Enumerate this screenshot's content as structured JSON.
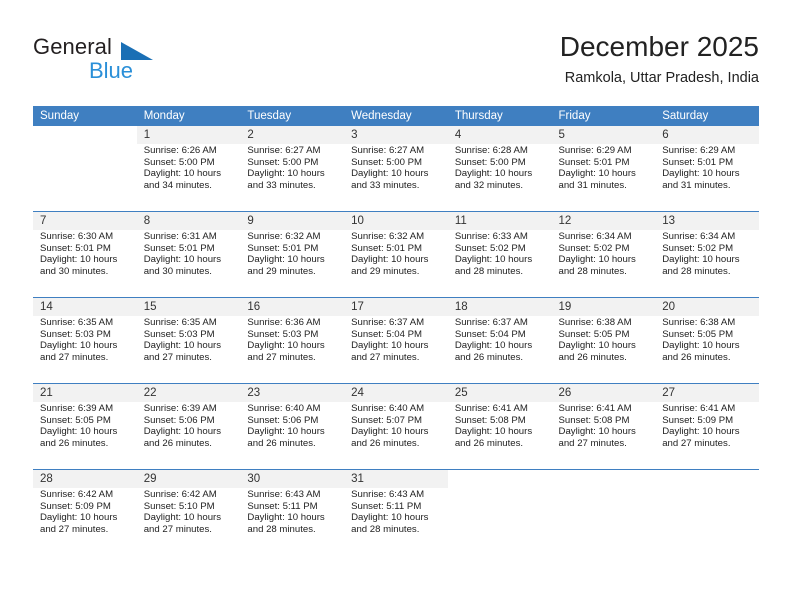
{
  "logo": {
    "word_dark": "General",
    "word_blue": "Blue",
    "triangle_color": "#1a6fb5",
    "blue_color": "#2a8fd8"
  },
  "header": {
    "title": "December 2025",
    "subtitle": "Ramkola, Uttar Pradesh, India"
  },
  "theme": {
    "header_bg": "#3f7fc1",
    "header_text": "#ffffff",
    "daynum_bg": "#f2f2f2",
    "cell_bg": "#ffffff"
  },
  "weekday_headers": [
    "Sunday",
    "Monday",
    "Tuesday",
    "Wednesday",
    "Thursday",
    "Friday",
    "Saturday"
  ],
  "weeks": [
    [
      {
        "day": "",
        "lines": []
      },
      {
        "day": "1",
        "lines": [
          "Sunrise: 6:26 AM",
          "Sunset: 5:00 PM",
          "Daylight: 10 hours",
          "and 34 minutes."
        ]
      },
      {
        "day": "2",
        "lines": [
          "Sunrise: 6:27 AM",
          "Sunset: 5:00 PM",
          "Daylight: 10 hours",
          "and 33 minutes."
        ]
      },
      {
        "day": "3",
        "lines": [
          "Sunrise: 6:27 AM",
          "Sunset: 5:00 PM",
          "Daylight: 10 hours",
          "and 33 minutes."
        ]
      },
      {
        "day": "4",
        "lines": [
          "Sunrise: 6:28 AM",
          "Sunset: 5:00 PM",
          "Daylight: 10 hours",
          "and 32 minutes."
        ]
      },
      {
        "day": "5",
        "lines": [
          "Sunrise: 6:29 AM",
          "Sunset: 5:01 PM",
          "Daylight: 10 hours",
          "and 31 minutes."
        ]
      },
      {
        "day": "6",
        "lines": [
          "Sunrise: 6:29 AM",
          "Sunset: 5:01 PM",
          "Daylight: 10 hours",
          "and 31 minutes."
        ]
      }
    ],
    [
      {
        "day": "7",
        "lines": [
          "Sunrise: 6:30 AM",
          "Sunset: 5:01 PM",
          "Daylight: 10 hours",
          "and 30 minutes."
        ]
      },
      {
        "day": "8",
        "lines": [
          "Sunrise: 6:31 AM",
          "Sunset: 5:01 PM",
          "Daylight: 10 hours",
          "and 30 minutes."
        ]
      },
      {
        "day": "9",
        "lines": [
          "Sunrise: 6:32 AM",
          "Sunset: 5:01 PM",
          "Daylight: 10 hours",
          "and 29 minutes."
        ]
      },
      {
        "day": "10",
        "lines": [
          "Sunrise: 6:32 AM",
          "Sunset: 5:01 PM",
          "Daylight: 10 hours",
          "and 29 minutes."
        ]
      },
      {
        "day": "11",
        "lines": [
          "Sunrise: 6:33 AM",
          "Sunset: 5:02 PM",
          "Daylight: 10 hours",
          "and 28 minutes."
        ]
      },
      {
        "day": "12",
        "lines": [
          "Sunrise: 6:34 AM",
          "Sunset: 5:02 PM",
          "Daylight: 10 hours",
          "and 28 minutes."
        ]
      },
      {
        "day": "13",
        "lines": [
          "Sunrise: 6:34 AM",
          "Sunset: 5:02 PM",
          "Daylight: 10 hours",
          "and 28 minutes."
        ]
      }
    ],
    [
      {
        "day": "14",
        "lines": [
          "Sunrise: 6:35 AM",
          "Sunset: 5:03 PM",
          "Daylight: 10 hours",
          "and 27 minutes."
        ]
      },
      {
        "day": "15",
        "lines": [
          "Sunrise: 6:35 AM",
          "Sunset: 5:03 PM",
          "Daylight: 10 hours",
          "and 27 minutes."
        ]
      },
      {
        "day": "16",
        "lines": [
          "Sunrise: 6:36 AM",
          "Sunset: 5:03 PM",
          "Daylight: 10 hours",
          "and 27 minutes."
        ]
      },
      {
        "day": "17",
        "lines": [
          "Sunrise: 6:37 AM",
          "Sunset: 5:04 PM",
          "Daylight: 10 hours",
          "and 27 minutes."
        ]
      },
      {
        "day": "18",
        "lines": [
          "Sunrise: 6:37 AM",
          "Sunset: 5:04 PM",
          "Daylight: 10 hours",
          "and 26 minutes."
        ]
      },
      {
        "day": "19",
        "lines": [
          "Sunrise: 6:38 AM",
          "Sunset: 5:05 PM",
          "Daylight: 10 hours",
          "and 26 minutes."
        ]
      },
      {
        "day": "20",
        "lines": [
          "Sunrise: 6:38 AM",
          "Sunset: 5:05 PM",
          "Daylight: 10 hours",
          "and 26 minutes."
        ]
      }
    ],
    [
      {
        "day": "21",
        "lines": [
          "Sunrise: 6:39 AM",
          "Sunset: 5:05 PM",
          "Daylight: 10 hours",
          "and 26 minutes."
        ]
      },
      {
        "day": "22",
        "lines": [
          "Sunrise: 6:39 AM",
          "Sunset: 5:06 PM",
          "Daylight: 10 hours",
          "and 26 minutes."
        ]
      },
      {
        "day": "23",
        "lines": [
          "Sunrise: 6:40 AM",
          "Sunset: 5:06 PM",
          "Daylight: 10 hours",
          "and 26 minutes."
        ]
      },
      {
        "day": "24",
        "lines": [
          "Sunrise: 6:40 AM",
          "Sunset: 5:07 PM",
          "Daylight: 10 hours",
          "and 26 minutes."
        ]
      },
      {
        "day": "25",
        "lines": [
          "Sunrise: 6:41 AM",
          "Sunset: 5:08 PM",
          "Daylight: 10 hours",
          "and 26 minutes."
        ]
      },
      {
        "day": "26",
        "lines": [
          "Sunrise: 6:41 AM",
          "Sunset: 5:08 PM",
          "Daylight: 10 hours",
          "and 27 minutes."
        ]
      },
      {
        "day": "27",
        "lines": [
          "Sunrise: 6:41 AM",
          "Sunset: 5:09 PM",
          "Daylight: 10 hours",
          "and 27 minutes."
        ]
      }
    ],
    [
      {
        "day": "28",
        "lines": [
          "Sunrise: 6:42 AM",
          "Sunset: 5:09 PM",
          "Daylight: 10 hours",
          "and 27 minutes."
        ]
      },
      {
        "day": "29",
        "lines": [
          "Sunrise: 6:42 AM",
          "Sunset: 5:10 PM",
          "Daylight: 10 hours",
          "and 27 minutes."
        ]
      },
      {
        "day": "30",
        "lines": [
          "Sunrise: 6:43 AM",
          "Sunset: 5:11 PM",
          "Daylight: 10 hours",
          "and 28 minutes."
        ]
      },
      {
        "day": "31",
        "lines": [
          "Sunrise: 6:43 AM",
          "Sunset: 5:11 PM",
          "Daylight: 10 hours",
          "and 28 minutes."
        ]
      },
      {
        "day": "",
        "lines": []
      },
      {
        "day": "",
        "lines": []
      },
      {
        "day": "",
        "lines": []
      }
    ]
  ]
}
